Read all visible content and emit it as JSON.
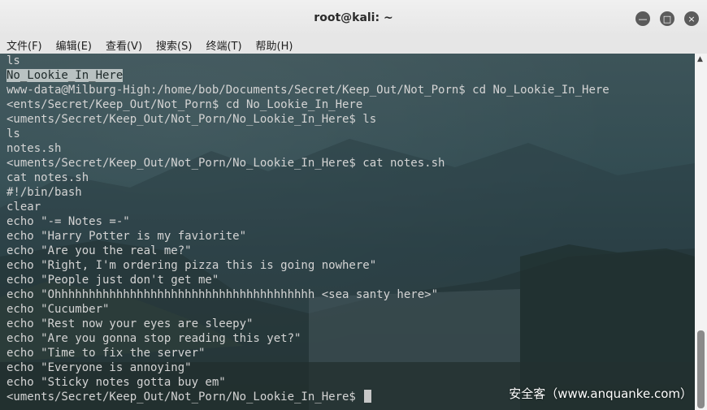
{
  "window": {
    "title": "root@kali: ~",
    "buttons": [
      "—",
      "□",
      "×"
    ]
  },
  "menu": [
    "文件(F)",
    "编辑(E)",
    "查看(V)",
    "搜索(S)",
    "终端(T)",
    "帮助(H)"
  ],
  "terminal": {
    "lines": [
      {
        "text": "ls",
        "selected": false
      },
      {
        "text": "No_Lookie_In_Here",
        "selected": true
      },
      {
        "text": "www-data@Milburg-High:/home/bob/Documents/Secret/Keep_Out/Not_Porn$ cd No_Lookie_In_Here",
        "selected": false
      },
      {
        "text": "<ents/Secret/Keep_Out/Not_Porn$ cd No_Lookie_In_Here",
        "selected": false
      },
      {
        "text": "<uments/Secret/Keep_Out/Not_Porn/No_Lookie_In_Here$ ls",
        "selected": false
      },
      {
        "text": "ls",
        "selected": false
      },
      {
        "text": "notes.sh",
        "selected": false
      },
      {
        "text": "<uments/Secret/Keep_Out/Not_Porn/No_Lookie_In_Here$ cat notes.sh",
        "selected": false
      },
      {
        "text": "cat notes.sh",
        "selected": false
      },
      {
        "text": "#!/bin/bash",
        "selected": false
      },
      {
        "text": "clear",
        "selected": false
      },
      {
        "text": "echo \"-= Notes =-\"",
        "selected": false
      },
      {
        "text": "echo \"Harry Potter is my faviorite\"",
        "selected": false
      },
      {
        "text": "echo \"Are you the real me?\"",
        "selected": false
      },
      {
        "text": "echo \"Right, I'm ordering pizza this is going nowhere\"",
        "selected": false
      },
      {
        "text": "echo \"People just don't get me\"",
        "selected": false
      },
      {
        "text": "echo \"Ohhhhhhhhhhhhhhhhhhhhhhhhhhhhhhhhhhhhhh <sea santy here>\"",
        "selected": false
      },
      {
        "text": "echo \"Cucumber\"",
        "selected": false
      },
      {
        "text": "echo \"Rest now your eyes are sleepy\"",
        "selected": false
      },
      {
        "text": "echo \"Are you gonna stop reading this yet?\"",
        "selected": false
      },
      {
        "text": "echo \"Time to fix the server\"",
        "selected": false
      },
      {
        "text": "echo \"Everyone is annoying\"",
        "selected": false
      },
      {
        "text": "echo \"Sticky notes gotta buy em\"",
        "selected": false
      },
      {
        "text": "<uments/Secret/Keep_Out/Not_Porn/No_Lookie_In_Here$ ",
        "selected": false,
        "cursor": true
      }
    ]
  },
  "watermark": "安全客（www.anquanke.com）"
}
